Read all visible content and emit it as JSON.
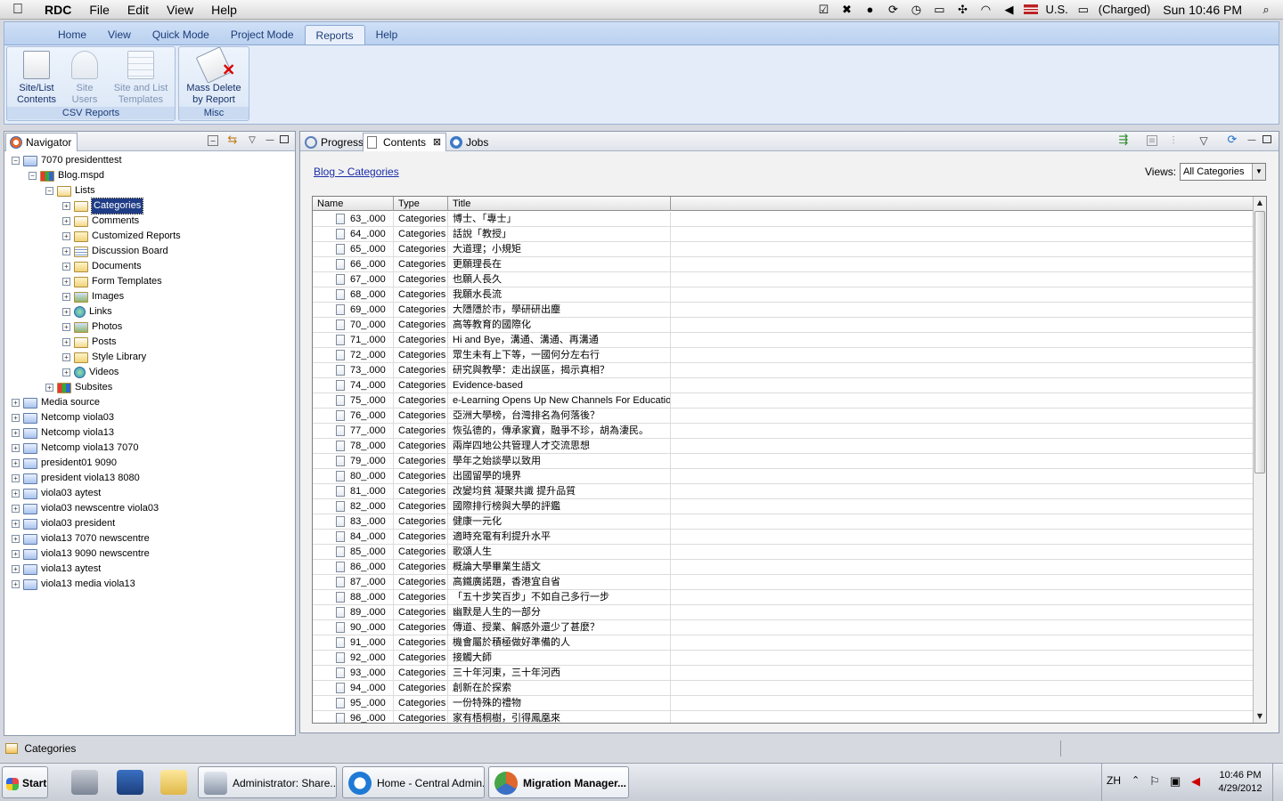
{
  "menubar": {
    "app": "RDC",
    "items": [
      "File",
      "Edit",
      "View",
      "Help"
    ],
    "input_source": "U.S.",
    "battery": "(Charged)",
    "clock": "Sun 10:46 PM"
  },
  "ribbon": {
    "tabs": [
      "Home",
      "View",
      "Quick Mode",
      "Project Mode",
      "Reports",
      "Help"
    ],
    "active_tab": "Reports",
    "groups": [
      {
        "label": "CSV Reports",
        "buttons": [
          [
            "Site/List",
            "Contents"
          ],
          [
            "Site",
            "Users"
          ],
          [
            "Site and List",
            "Templates"
          ]
        ]
      },
      {
        "label": "Misc",
        "buttons": [
          [
            "Mass Delete",
            "by Report"
          ]
        ]
      }
    ]
  },
  "navigator": {
    "tab": "Navigator",
    "tree": [
      {
        "label": "7070 presidenttest",
        "level": 0,
        "expander": "−",
        "type": "site"
      },
      {
        "label": "Blog.mspd",
        "level": 1,
        "expander": "−",
        "type": "blocks"
      },
      {
        "label": "Lists",
        "level": 2,
        "expander": "−",
        "type": "list"
      },
      {
        "label": "Categories",
        "level": 3,
        "expander": "+",
        "type": "list",
        "selected": true
      },
      {
        "label": "Comments",
        "level": 3,
        "expander": "+",
        "type": "list"
      },
      {
        "label": "Customized Reports",
        "level": 3,
        "expander": "+",
        "type": "folder"
      },
      {
        "label": "Discussion Board",
        "level": 3,
        "expander": "+",
        "type": "doc"
      },
      {
        "label": "Documents",
        "level": 3,
        "expander": "+",
        "type": "folder"
      },
      {
        "label": "Form Templates",
        "level": 3,
        "expander": "+",
        "type": "folder"
      },
      {
        "label": "Images",
        "level": 3,
        "expander": "+",
        "type": "img"
      },
      {
        "label": "Links",
        "level": 3,
        "expander": "+",
        "type": "globe"
      },
      {
        "label": "Photos",
        "level": 3,
        "expander": "+",
        "type": "img"
      },
      {
        "label": "Posts",
        "level": 3,
        "expander": "+",
        "type": "list"
      },
      {
        "label": "Style Library",
        "level": 3,
        "expander": "+",
        "type": "folder"
      },
      {
        "label": "Videos",
        "level": 3,
        "expander": "+",
        "type": "globe"
      },
      {
        "label": "Subsites",
        "level": 2,
        "expander": "+",
        "type": "blocks"
      },
      {
        "label": "Media source",
        "level": 0,
        "expander": "+",
        "type": "site"
      },
      {
        "label": "Netcomp viola03",
        "level": 0,
        "expander": "+",
        "type": "site"
      },
      {
        "label": "Netcomp viola13",
        "level": 0,
        "expander": "+",
        "type": "site"
      },
      {
        "label": "Netcomp viola13 7070",
        "level": 0,
        "expander": "+",
        "type": "site"
      },
      {
        "label": "president01 9090",
        "level": 0,
        "expander": "+",
        "type": "site"
      },
      {
        "label": "president viola13 8080",
        "level": 0,
        "expander": "+",
        "type": "site"
      },
      {
        "label": "viola03 aytest",
        "level": 0,
        "expander": "+",
        "type": "site"
      },
      {
        "label": "viola03 newscentre viola03",
        "level": 0,
        "expander": "+",
        "type": "site"
      },
      {
        "label": "viola03 president",
        "level": 0,
        "expander": "+",
        "type": "site"
      },
      {
        "label": "viola13 7070 newscentre",
        "level": 0,
        "expander": "+",
        "type": "site"
      },
      {
        "label": "viola13 9090 newscentre",
        "level": 0,
        "expander": "+",
        "type": "site"
      },
      {
        "label": "viola13 aytest",
        "level": 0,
        "expander": "+",
        "type": "site"
      },
      {
        "label": "viola13 media viola13",
        "level": 0,
        "expander": "+",
        "type": "site"
      }
    ]
  },
  "content": {
    "tabs": [
      "Progress",
      "Contents",
      "Jobs"
    ],
    "active_tab": "Contents",
    "close_glyph": "⊠",
    "breadcrumb": "Blog > Categories",
    "views_label": "Views:",
    "views_value": "All Categories",
    "columns": [
      "Name",
      "Type",
      "Title"
    ],
    "rows": [
      [
        "63_.000",
        "Categories",
        "博士、「專士」"
      ],
      [
        "64_.000",
        "Categories",
        "話說「教授」"
      ],
      [
        "65_.000",
        "Categories",
        "大道理；小規矩"
      ],
      [
        "66_.000",
        "Categories",
        "更願理長在"
      ],
      [
        "67_.000",
        "Categories",
        "也願人長久"
      ],
      [
        "68_.000",
        "Categories",
        "我願水長流"
      ],
      [
        "69_.000",
        "Categories",
        "大隱隱於市，學研研出塵"
      ],
      [
        "70_.000",
        "Categories",
        "高等教育的國際化"
      ],
      [
        "71_.000",
        "Categories",
        "Hi and Bye，溝通、溝通、再溝通"
      ],
      [
        "72_.000",
        "Categories",
        "眾生未有上下等，一國何分左右行"
      ],
      [
        "73_.000",
        "Categories",
        "研究與教學：走出誤區，揭示真相？"
      ],
      [
        "74_.000",
        "Categories",
        "Evidence-based"
      ],
      [
        "75_.000",
        "Categories",
        "e-Learning Opens Up New Channels For Education"
      ],
      [
        "76_.000",
        "Categories",
        "亞洲大學榜，台灣排名為何落後？"
      ],
      [
        "77_.000",
        "Categories",
        "恢弘德的，傳承家寶，融爭不珍，胡為淒民。"
      ],
      [
        "78_.000",
        "Categories",
        "兩岸四地公共管理人才交流思想"
      ],
      [
        "79_.000",
        "Categories",
        "學年之始談學以致用"
      ],
      [
        "80_.000",
        "Categories",
        "出國留學的境界"
      ],
      [
        "81_.000",
        "Categories",
        "改變均貧 凝聚共識 提升品質"
      ],
      [
        "82_.000",
        "Categories",
        "國際排行榜與大學的評鑑"
      ],
      [
        "83_.000",
        "Categories",
        "健康一元化"
      ],
      [
        "84_.000",
        "Categories",
        "適時充電有利提升水平"
      ],
      [
        "85_.000",
        "Categories",
        "歌頌人生"
      ],
      [
        "86_.000",
        "Categories",
        "概論大學畢業生語文"
      ],
      [
        "87_.000",
        "Categories",
        "高鐵廣諾題，香港宜自省"
      ],
      [
        "88_.000",
        "Categories",
        "「五十步笑百步」不如自己多行一步"
      ],
      [
        "89_.000",
        "Categories",
        "幽默是人生的一部分"
      ],
      [
        "90_.000",
        "Categories",
        "傳道、授業、解惑外還少了甚麼？"
      ],
      [
        "91_.000",
        "Categories",
        "機會屬於積極做好準備的人"
      ],
      [
        "92_.000",
        "Categories",
        "接觸大師"
      ],
      [
        "93_.000",
        "Categories",
        "三十年河東，三十年河西"
      ],
      [
        "94_.000",
        "Categories",
        "創新在於探索"
      ],
      [
        "95_.000",
        "Categories",
        "一份特殊的禮物"
      ],
      [
        "96_.000",
        "Categories",
        "家有梧桐樹，引得鳳凰來"
      ]
    ]
  },
  "status": {
    "text": "Categories"
  },
  "taskbar": {
    "start": "Start",
    "tasks": [
      "Administrator: Share...",
      "Home - Central Admin...",
      "Migration Manager..."
    ],
    "lang": "ZH",
    "time": "10:46 PM",
    "date": "4/29/2012"
  },
  "colors": {
    "selection": "#1f3d86",
    "ribbon_text": "#15306a",
    "link": "#1a2ea8"
  }
}
